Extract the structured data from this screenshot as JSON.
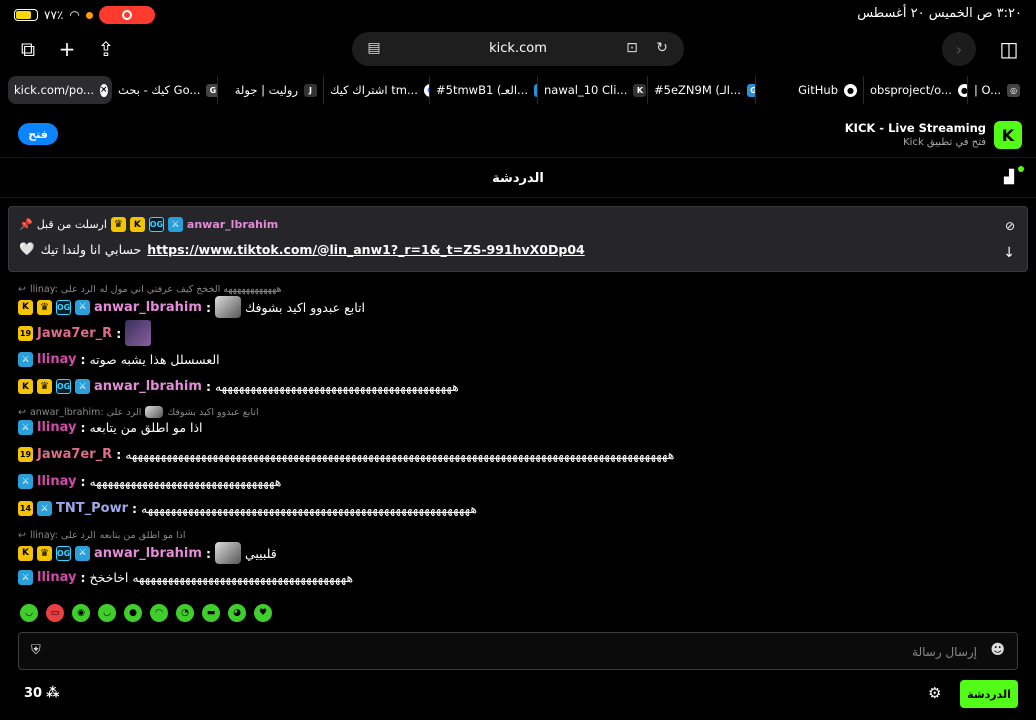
{
  "status": {
    "battery": "٧٧٪",
    "datetime": "٣:٢٠ ص  الخميس ٢٠ أغسطس"
  },
  "browser": {
    "url": "kick.com",
    "tabs": [
      {
        "label": "kick.com/po...",
        "icon": "close-icon",
        "active": true
      },
      {
        "label": "كيك - بحث Go...",
        "icon": "G"
      },
      {
        "label": "روليت | جولة",
        "icon": "J"
      },
      {
        "label": "اشتراك كيك tm...",
        "icon": "google-icon"
      },
      {
        "label": "#5tmwB1 (العـ...",
        "icon": "G"
      },
      {
        "label": "nawal_10 Cli...",
        "icon": "K"
      },
      {
        "label": "#5eZN9M (الـ...",
        "icon": "G"
      },
      {
        "label": "GitHub",
        "icon": "github-icon"
      },
      {
        "label": "obsproject/o...",
        "icon": "github-icon"
      },
      {
        "label": "| O...",
        "icon": "globe-icon"
      }
    ]
  },
  "banner": {
    "open_label": "فتح",
    "app_title": "KICK - Live Streaming",
    "app_subtitle": "فتح في تطبيق Kick",
    "logo": "K"
  },
  "chat": {
    "title": "الدردشة",
    "pinned": {
      "user": "anwar_lbrahim",
      "label": "ارسلت من قبل",
      "link": "https://www.tiktok.com/@lin_anw1?_r=1&_t=ZS-991hvX0Dp04",
      "text_after": "حسابي انا ولندا تيك"
    },
    "messages": [
      {
        "reply": "llinay: الرد على",
        "reply_text": "ههههههههههههه الخخخ كيف عرفتي اني مول له"
      },
      {
        "user": "anwar_lbrahim",
        "text": "اتابع عبدوو اكيد بشوفك"
      },
      {
        "user": "Jawa7er_R",
        "text": ""
      },
      {
        "user": "llinay",
        "text": "العسسلل هذا يشبه صوته"
      },
      {
        "user": "anwar_lbrahim",
        "text": "هههههههههههههههههههههههههههههههههههههههههه"
      },
      {
        "reply": "anwar_lbrahim: الرد على",
        "reply_text": "اتابع عبدوو اكيد بشوفك"
      },
      {
        "user": "llinay",
        "text": "اذا مو اطلق من يتابعه"
      },
      {
        "user": "Jawa7er_R",
        "text": "ههههههههههههههههههههههههههههههههههههههههههههههههههههههههههههههههههههههههههههههههههههههههههههههه"
      },
      {
        "user": "llinay",
        "text": "ههههههههههههههههههههههههههههههههه"
      },
      {
        "user": "TNT_Powr",
        "text": "هههههههههههههههههههههههههههههههههههههههههههههههههههههههههه"
      },
      {
        "reply": "llinay: الرد على",
        "reply_text": "اذا مو اطلق من يتابعه"
      },
      {
        "user": "anwar_lbrahim",
        "text": "قلبييي"
      },
      {
        "user": "llinay",
        "text": "هههههههههههههههههههههههههههههههههههههه اخاخخخ"
      }
    ],
    "input_placeholder": "إرسال رسالة",
    "send_label": "الدردشة",
    "viewers": "30",
    "badge_numbers": {
      "jawa": "19",
      "tnt": "14"
    }
  }
}
